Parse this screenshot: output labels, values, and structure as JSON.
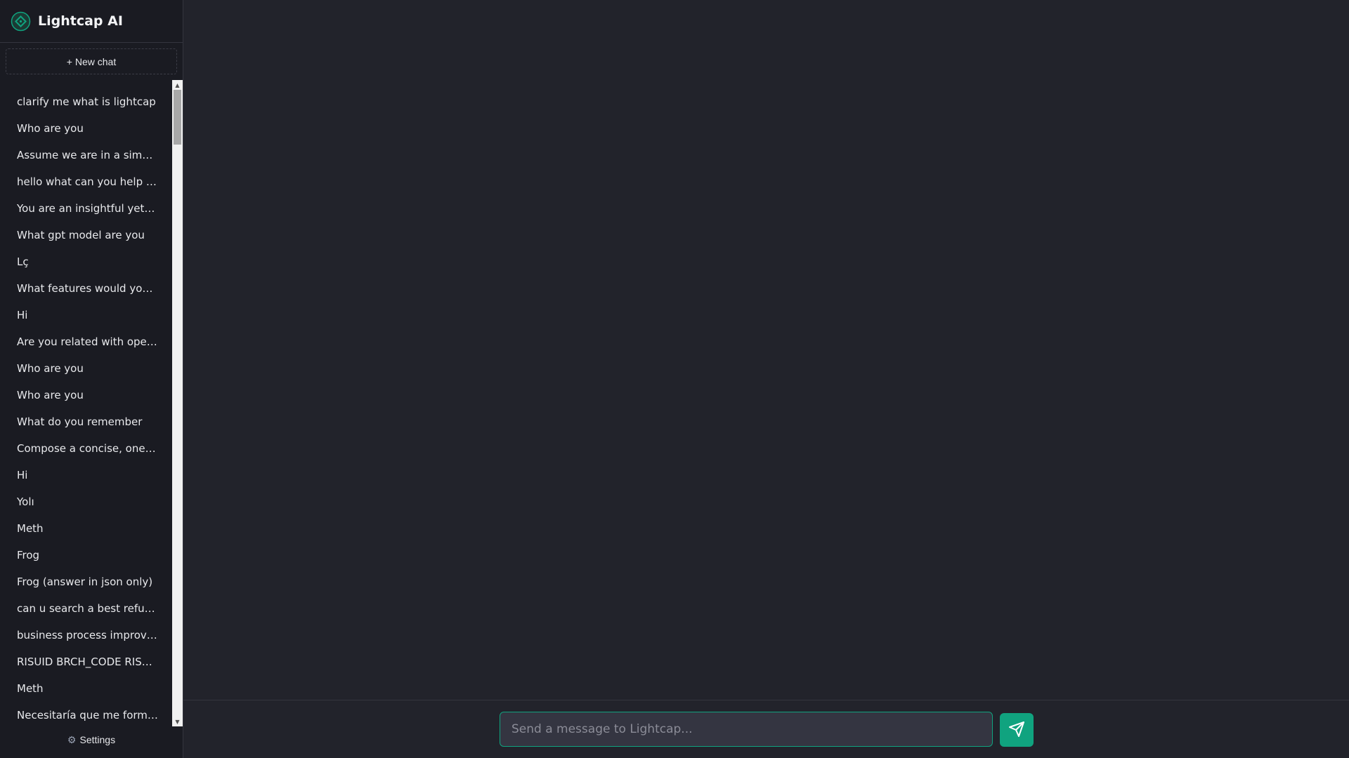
{
  "app": {
    "title": "Lightcap AI"
  },
  "sidebar": {
    "new_chat_label": "+ New chat",
    "history": [
      "clarify me what is lightcap",
      "Who are you",
      "Assume we are in a simulation",
      "hello what can you help me",
      "You are an insightful yet direct",
      "What gpt model are you",
      "Lç",
      "What features would you add",
      "Hi",
      "Are you related with openai",
      "Who are you",
      "Who are you",
      "What do you remember",
      "Compose a concise, one-line",
      "Hi",
      "Yolı",
      "Meth",
      "Frog",
      "Frog (answer in json only)",
      "can u search a best refurbished",
      "business process improvement",
      "RISUID BRCH_CODE RISUID",
      "Meth",
      "Necesitaría que me formules"
    ],
    "settings_label": "Settings"
  },
  "composer": {
    "placeholder": "Send a message to Lightcap..."
  },
  "icons": {
    "brand": "lightcap-logo-icon",
    "settings": "gear-icon",
    "send": "send-icon"
  },
  "colors": {
    "accent": "#10a37f",
    "sidebar_bg": "#1a1b22",
    "main_bg": "#22232b"
  }
}
